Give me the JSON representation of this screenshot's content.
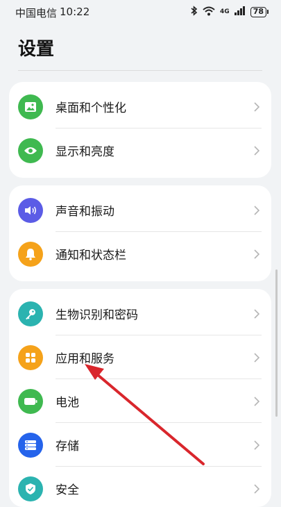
{
  "status_bar": {
    "carrier": "中国电信",
    "time": "10:22",
    "network": "4G",
    "battery": "78"
  },
  "page": {
    "title": "设置"
  },
  "groups": [
    {
      "items": [
        {
          "label": "桌面和个性化",
          "icon": "image-icon",
          "color": "#3fb950"
        },
        {
          "label": "显示和亮度",
          "icon": "eye-icon",
          "color": "#3fb950"
        }
      ]
    },
    {
      "items": [
        {
          "label": "声音和振动",
          "icon": "speaker-icon",
          "color": "#5b5ce6"
        },
        {
          "label": "通知和状态栏",
          "icon": "bell-icon",
          "color": "#f5a21a"
        }
      ]
    },
    {
      "items": [
        {
          "label": "生物识别和密码",
          "icon": "key-icon",
          "color": "#2bb3b0"
        },
        {
          "label": "应用和服务",
          "icon": "grid-icon",
          "color": "#f5a21a"
        },
        {
          "label": "电池",
          "icon": "battery-icon",
          "color": "#3fb950"
        },
        {
          "label": "存储",
          "icon": "storage-icon",
          "color": "#2563eb"
        },
        {
          "label": "安全",
          "icon": "shield-icon",
          "color": "#2bb3b0"
        }
      ]
    }
  ],
  "annotation": {
    "arrow_color": "#d9262c"
  }
}
